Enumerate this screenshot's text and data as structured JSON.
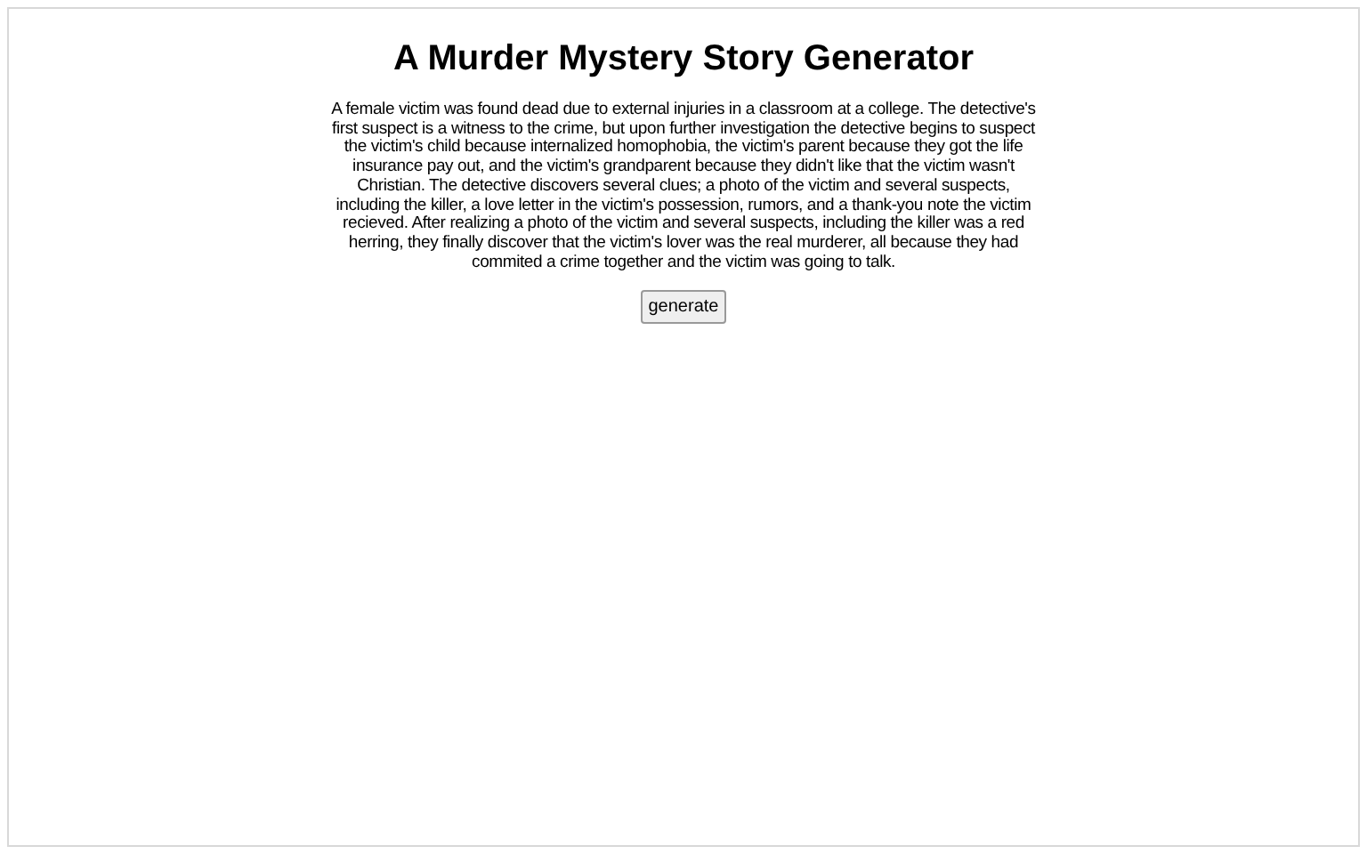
{
  "title": "A Murder Mystery Story Generator",
  "story": "A female victim was found dead due to external injuries in a classroom at a college. The detective's first suspect is a witness to the crime, but upon further investigation the detective begins to suspect the victim's child because internalized homophobia, the victim's parent because they got the life insurance pay out, and the victim's grandparent because they didn't like that the victim wasn't Christian. The detective discovers several clues; a photo of the victim and several suspects, including the killer, a love letter in the victim's possession, rumors, and a thank-you note the victim recieved. After realizing a photo of the victim and several suspects, including the killer was a red herring, they finally discover that the victim's lover was the real murderer, all because they had commited a crime together and the victim was going to talk.",
  "button": "generate"
}
